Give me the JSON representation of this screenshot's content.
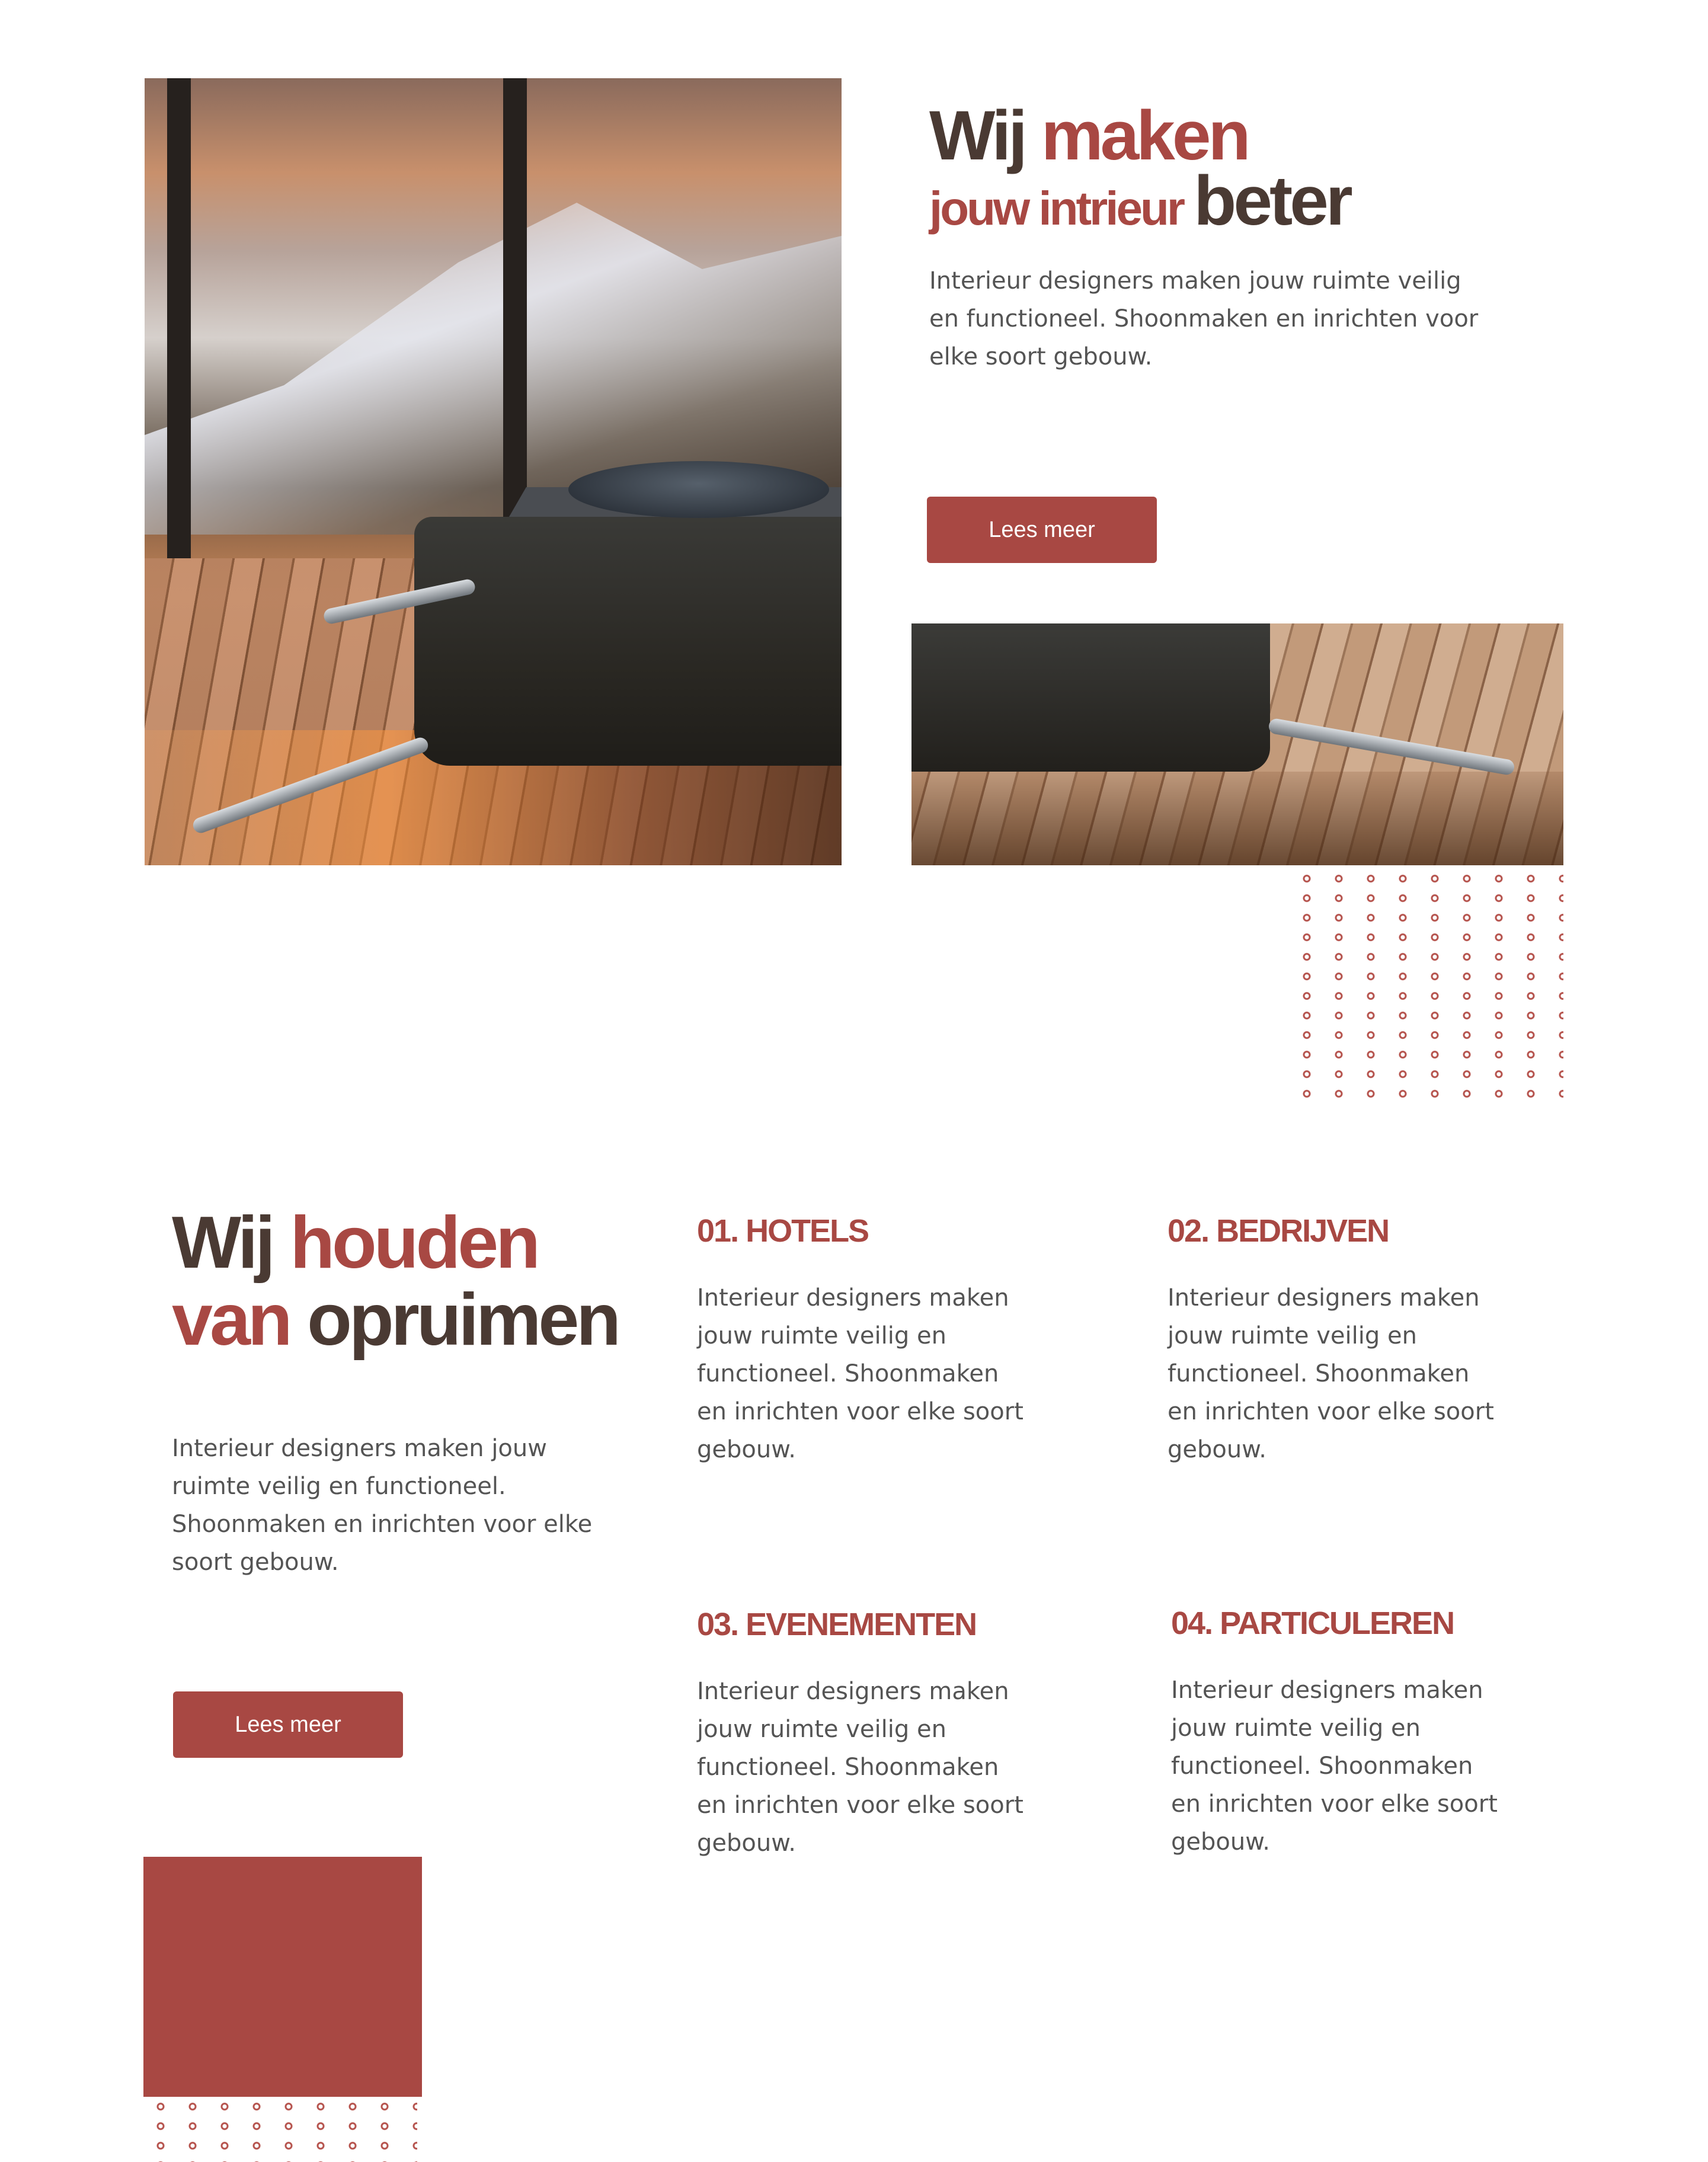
{
  "hero": {
    "title_part1": "Wij ",
    "title_part2": "maken",
    "title_part3": "jouw intrieur ",
    "title_part4": "beter",
    "paragraph": "Interieur designers maken jouw ruimte veilig en functioneel. Shoonmaken en inrichten voor elke soort gebouw.",
    "button_label": "Lees meer"
  },
  "section2": {
    "title_part1": "Wij ",
    "title_part2": "houden",
    "title_part3": "van ",
    "title_part4": "opruimen",
    "paragraph": "Interieur designers maken jouw ruimte veilig en functioneel. Shoonmaken en inrichten voor elke soort gebouw.",
    "button_label": "Lees meer"
  },
  "services": [
    {
      "title": "01. HOTELS",
      "text": "Interieur designers maken jouw ruimte veilig en functioneel. Shoonmaken en inrichten voor elke soort gebouw."
    },
    {
      "title": "02. BEDRIJVEN",
      "text": "Interieur designers maken jouw ruimte veilig en functioneel. Shoonmaken en inrichten voor elke soort gebouw."
    },
    {
      "title": "03. EVENEMENTEN",
      "text": "Interieur designers maken jouw ruimte veilig en functioneel. Shoonmaken en inrichten voor elke soort gebouw."
    },
    {
      "title": "04. PARTICULEREN",
      "text": "Interieur designers maken jouw ruimte veilig en functioneel. Shoonmaken en inrichten voor elke soort gebouw."
    }
  ],
  "colors": {
    "accent": "#a84843",
    "heading_dark": "#4a3a33",
    "body_text": "#545454",
    "background": "#ffffff"
  }
}
